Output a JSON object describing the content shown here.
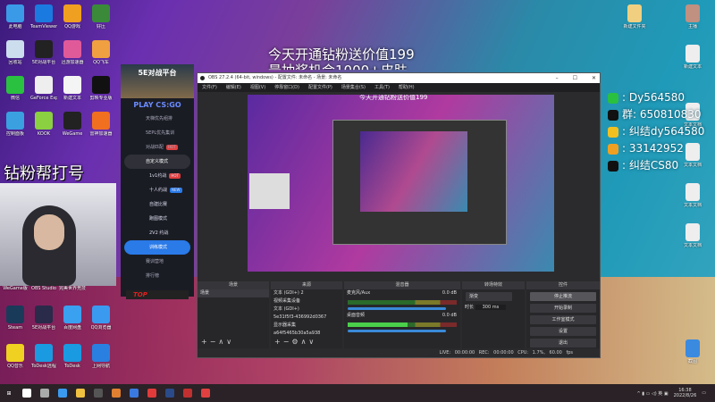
{
  "desktop_left": [
    {
      "label": "此电脑",
      "color": "#3a9ae8"
    },
    {
      "label": "TeamViewer",
      "color": "#1a7ae0"
    },
    {
      "label": "QQ游戏",
      "color": "#f0a020"
    },
    {
      "label": "好压",
      "color": "#3a8a3a"
    },
    {
      "label": "回收站",
      "color": "#cde"
    },
    {
      "label": "5E对战平台",
      "color": "#222"
    },
    {
      "label": "迅游加速器",
      "color": "#e05a9a"
    },
    {
      "label": "QQ飞车",
      "color": "#f0a040"
    },
    {
      "label": "微信",
      "color": "#2ac040"
    },
    {
      "label": "GeForce Experience",
      "color": "#eee"
    },
    {
      "label": "新建文本",
      "color": "#f4f4f4"
    },
    {
      "label": "剪映专业版",
      "color": "#111"
    },
    {
      "label": "控制面板",
      "color": "#3aa0e0"
    },
    {
      "label": "KOOK",
      "color": "#8ad040"
    },
    {
      "label": "WeGame",
      "color": "#222"
    },
    {
      "label": "雷神加速器",
      "color": "#f07020"
    }
  ],
  "desktop_left_bottom": [
    {
      "label": "WeGame版",
      "color": "#444"
    },
    {
      "label": "OBS Studio",
      "color": "#333"
    },
    {
      "label": "完美世界竞技平台",
      "color": "#333"
    },
    {
      "label": "",
      "color": "#333"
    },
    {
      "label": "Steam",
      "color": "#1a3a5a"
    },
    {
      "label": "5E对战平台",
      "color": "#2a2a4a"
    },
    {
      "label": "百度网盘",
      "color": "#3aa0f0"
    },
    {
      "label": "QQ浏览器",
      "color": "#3a9af0"
    },
    {
      "label": "QQ音乐",
      "color": "#f0d020"
    },
    {
      "label": "ToDesk远程",
      "color": "#1a9ae0"
    },
    {
      "label": "ToDesk",
      "color": "#1a9ae0"
    },
    {
      "label": "上网导航",
      "color": "#2a80e0"
    }
  ],
  "desktop_right": [
    {
      "label": "新建文件夹",
      "color": "#f0d080"
    },
    {
      "label": "主播",
      "color": "#c09080"
    },
    {
      "label": "新建文本",
      "color": "#eee"
    },
    {
      "label": "文本文档",
      "color": "#eee"
    },
    {
      "label": "文本文档",
      "color": "#eee"
    },
    {
      "label": "文本文档",
      "color": "#eee"
    },
    {
      "label": "文本文档",
      "color": "#eee"
    },
    {
      "label": "截图",
      "color": "#3a8ae0"
    }
  ],
  "overlay": {
    "line1": "今天开通钻粉送价值199",
    "line2": "最抽奖机会1000+皮肤",
    "webcam_caption": "钻粉帮打号"
  },
  "platform": {
    "logo": "5E对战平台",
    "play": "PLAY CS:GO",
    "items": [
      {
        "label": "天梯优先组排",
        "cls": ""
      },
      {
        "label": "5EPL优先集训",
        "cls": ""
      },
      {
        "label": "对战匹配",
        "cls": "",
        "badge": "HOT"
      },
      {
        "label": "自定义模式",
        "cls": "act"
      },
      {
        "label": "1v1约战",
        "cls": "sub",
        "badge": "HOT"
      },
      {
        "label": "十人约战",
        "cls": "sub",
        "badge": "NEW",
        "badge_blue": true
      },
      {
        "label": "自建比赛",
        "cls": "sub"
      },
      {
        "label": "跑图模式",
        "cls": "sub"
      },
      {
        "label": "2V2 约战",
        "cls": "sub"
      },
      {
        "label": "训练模式",
        "cls": "blue"
      },
      {
        "label": "赛训营地",
        "cls": ""
      },
      {
        "label": "排行榜",
        "cls": ""
      }
    ],
    "top": "TOP"
  },
  "obs": {
    "title": "OBS 27.2.4 (64-bit, windows) - 配置文件: 未命名 - 场景: 未命名",
    "menu": [
      "文件(F)",
      "编辑(E)",
      "视图(V)",
      "停靠窗口(D)",
      "配置文件(P)",
      "场景集合(S)",
      "工具(T)",
      "帮助(H)"
    ],
    "preview_text": "今天开通钻粉送价值199",
    "docks": {
      "scenes_title": "场景",
      "scenes": [
        "场景"
      ],
      "sources_title": "来源",
      "sources": [
        "文本 (GDI+) 2",
        "视频采集设备",
        "文本 (GDI+)",
        "5e31f5f3-436992d0367",
        "显示器采集",
        "a64f5465b30a5a938"
      ],
      "mixer_title": "混音器",
      "mixer": [
        {
          "name": "麦克风/Aux",
          "db": "0.0 dB"
        },
        {
          "name": "桌面音频",
          "db": "0.0 dB"
        }
      ],
      "transitions_title": "转场特效",
      "transition": "渐变",
      "duration_label": "时长",
      "duration": "300 ms",
      "controls_title": "控件",
      "controls": [
        "停止推流",
        "开始录制",
        "工作室模式",
        "设置",
        "退出"
      ]
    },
    "status": "LIVE: 00:00:00   REC: 00:00:00   CPU: 1.7%, 60.00 fps"
  },
  "contacts": [
    {
      "text": ": Dy564580",
      "color": "#2ac040"
    },
    {
      "text": "群: 650810830",
      "color": "#111"
    },
    {
      "text": ": 纠结dy564580",
      "color": "#f0c020"
    },
    {
      "text": ": 33142952",
      "color": "#f0a020"
    },
    {
      "text": ": 纠结CS80",
      "color": "#111"
    }
  ],
  "taskbar": {
    "apps": [
      "#fff",
      "#aaa",
      "#3a9af0",
      "#f0c040",
      "#555",
      "#e08030",
      "#3a7ae0",
      "#e03a3a",
      "#2a4a8a",
      "#c03030",
      "#e04040"
    ],
    "time": "16:38",
    "date": "2022/8/26"
  }
}
